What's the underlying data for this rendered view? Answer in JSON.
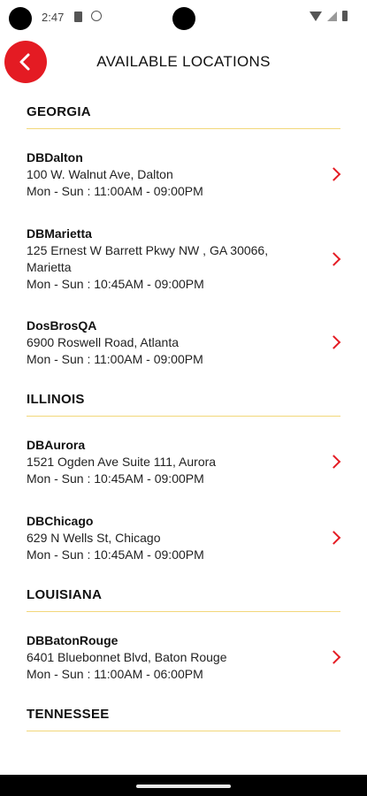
{
  "status_bar": {
    "time": "2:47"
  },
  "header": {
    "title": "AVAILABLE LOCATIONS"
  },
  "states": [
    {
      "name": "GEORGIA",
      "locations": [
        {
          "name": "DBDalton",
          "address": "100 W. Walnut Ave, Dalton",
          "hours": "Mon - Sun : 11:00AM - 09:00PM"
        },
        {
          "name": "DBMarietta",
          "address": "125 Ernest W Barrett Pkwy NW , GA 30066,",
          "address2": "Marietta",
          "hours": "Mon - Sun : 10:45AM - 09:00PM"
        },
        {
          "name": "DosBrosQA",
          "address": "6900 Roswell Road, Atlanta",
          "hours": "Mon - Sun : 11:00AM - 09:00PM"
        }
      ]
    },
    {
      "name": "ILLINOIS",
      "locations": [
        {
          "name": "DBAurora",
          "address": "1521 Ogden Ave Suite 111, Aurora",
          "hours": "Mon - Sun : 10:45AM - 09:00PM"
        },
        {
          "name": "DBChicago",
          "address": "629 N Wells St, Chicago",
          "hours": "Mon - Sun : 10:45AM - 09:00PM"
        }
      ]
    },
    {
      "name": "LOUISIANA",
      "locations": [
        {
          "name": "DBBatonRouge",
          "address": "6401 Bluebonnet Blvd, Baton Rouge",
          "hours": "Mon - Sun : 11:00AM - 06:00PM"
        }
      ]
    },
    {
      "name": "TENNESSEE",
      "locations": []
    }
  ],
  "colors": {
    "accent": "#e41b23",
    "divider": "#f2d77a"
  },
  "icons": {
    "back": "chevron-left-icon",
    "row": "chevron-right-icon"
  }
}
